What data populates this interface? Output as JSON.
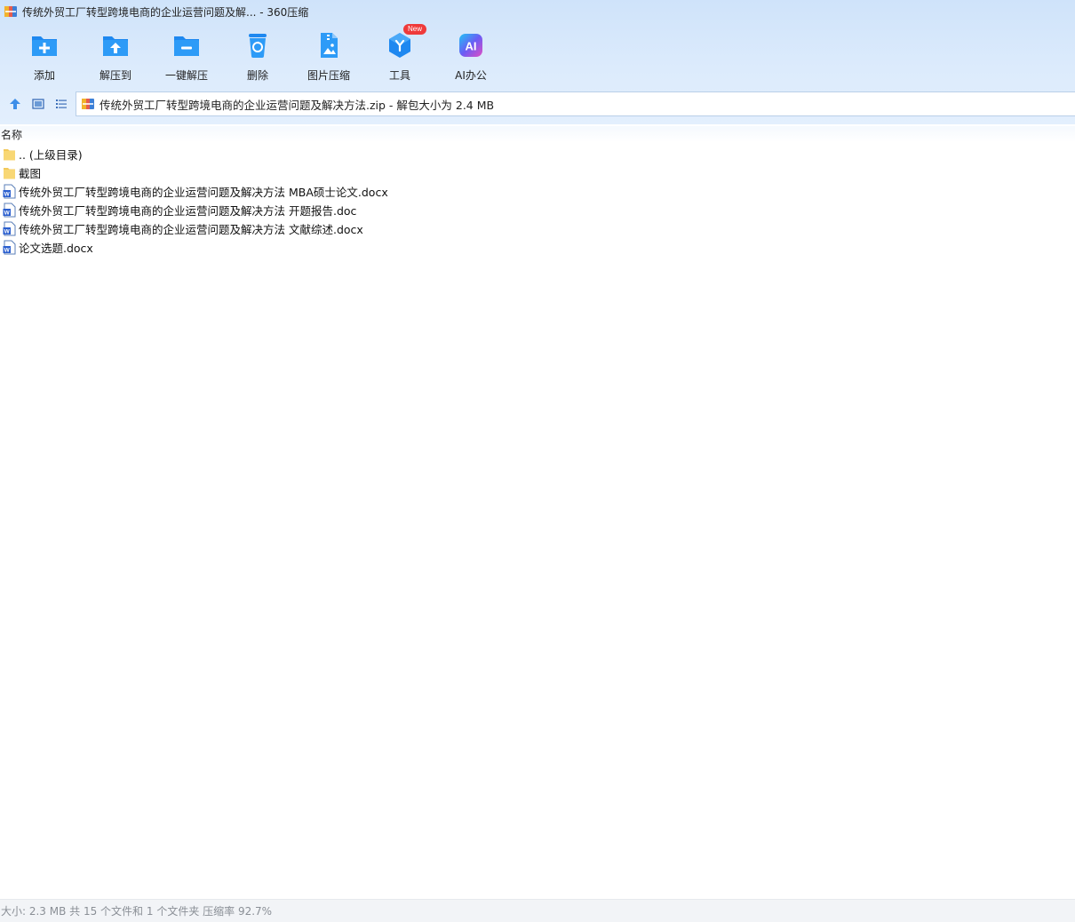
{
  "window": {
    "title": "传统外贸工厂转型跨境电商的企业运营问题及解... - 360压缩"
  },
  "toolbar": {
    "items": [
      {
        "label": "添加",
        "icon": "add-folder-icon"
      },
      {
        "label": "解压到",
        "icon": "extract-to-folder-icon"
      },
      {
        "label": "一键解压",
        "icon": "one-click-extract-icon"
      },
      {
        "label": "删除",
        "icon": "recycle-bin-icon"
      },
      {
        "label": "图片压缩",
        "icon": "image-compress-icon"
      },
      {
        "label": "工具",
        "icon": "tools-cube-icon",
        "badge": "New"
      },
      {
        "label": "AI办公",
        "icon": "ai-office-icon",
        "icon_text": "AI"
      }
    ]
  },
  "navbar": {
    "buttons": [
      "up-arrow-icon",
      "thumbnail-view-icon",
      "list-view-icon"
    ],
    "path": "传统外贸工厂转型跨境电商的企业运营问题及解决方法.zip - 解包大小为 2.4 MB"
  },
  "list": {
    "column_name": "名称",
    "files": [
      {
        "name": ".. (上级目录)",
        "type": "folder"
      },
      {
        "name": "截图",
        "type": "folder"
      },
      {
        "name": "传统外贸工厂转型跨境电商的企业运营问题及解决方法 MBA硕士论文.docx",
        "type": "word"
      },
      {
        "name": "传统外贸工厂转型跨境电商的企业运营问题及解决方法 开题报告.doc",
        "type": "word"
      },
      {
        "name": "传统外贸工厂转型跨境电商的企业运营问题及解决方法 文献综述.docx",
        "type": "word"
      },
      {
        "name": "论文选题.docx",
        "type": "word"
      }
    ]
  },
  "status": {
    "text": "大小: 2.3 MB 共 15 个文件和 1 个文件夹 压缩率 92.7%"
  },
  "colors": {
    "toolbar_bg": "#d6e7fb",
    "icon_blue": "#1e88f0",
    "badge_red": "#ef3a3a",
    "folder_yellow": "#f8d774",
    "word_blue": "#2b5fcf",
    "status_text": "#8a8f96"
  }
}
